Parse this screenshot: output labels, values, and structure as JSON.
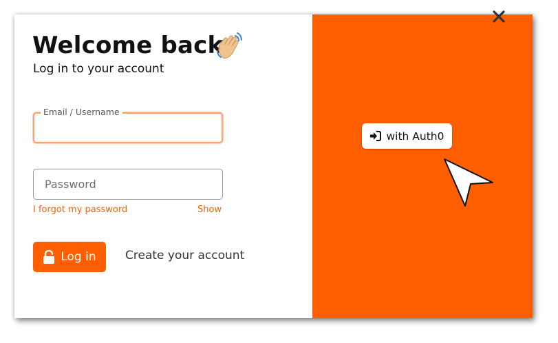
{
  "login": {
    "title": "Welcome back",
    "subtitle": "Log in to your account",
    "email_legend": "Email / Username",
    "email_value": "",
    "password_placeholder": "Password",
    "forgot_link": "I forgot my password",
    "show_link": "Show",
    "login_button": "Log in",
    "create_account_link": "Create your account"
  },
  "social": {
    "auth_button": "with Auth0",
    "close_icon": "close-icon"
  },
  "icons": {
    "wave": "waving-hand-icon",
    "lock": "unlock-icon",
    "signin": "sign-in-icon",
    "cursor": "mouse-pointer-icon"
  },
  "colors": {
    "accent": "#ff5f00",
    "panel": "#ff5f00",
    "text": "#111111"
  }
}
